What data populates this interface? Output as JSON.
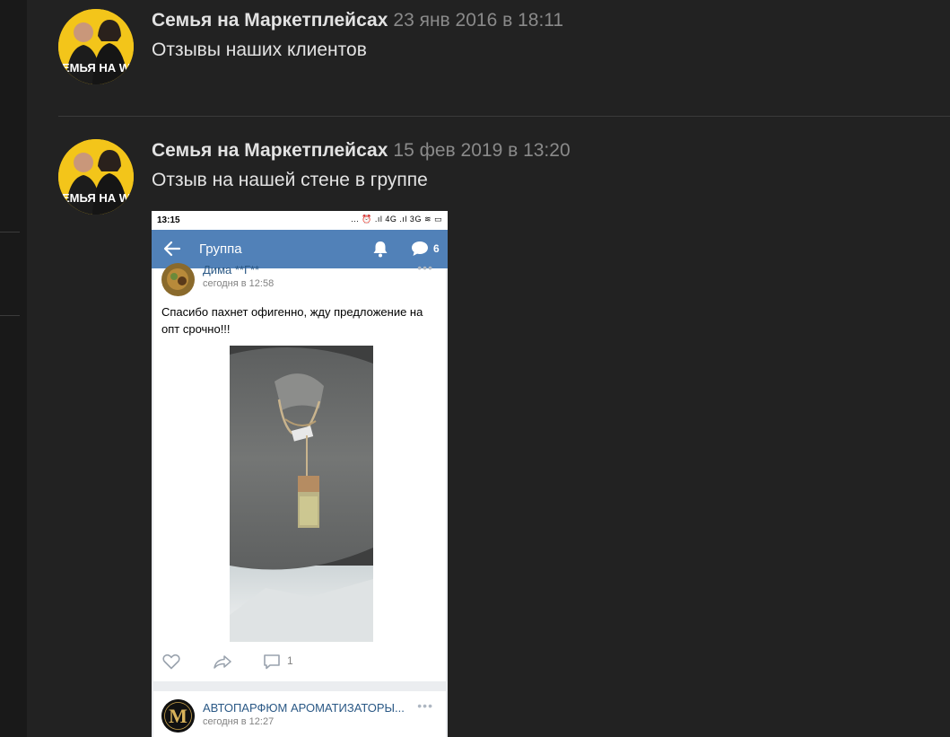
{
  "posts": [
    {
      "author": "Семья на Маркетплейсах",
      "date": "23 янв 2016 в 18:11",
      "text": "Отзывы наших клиентов",
      "avatar_text": "СЕМЬЯ НА WB"
    },
    {
      "author": "Семья на Маркетплейсах",
      "date": "15 фев 2019 в 13:20",
      "text": "Отзыв на нашей стене в группе",
      "avatar_text": "СЕМЬЯ НА WB"
    }
  ],
  "phone": {
    "status_time": "13:15",
    "status_icons": "... ⏰ .ıl 4G .ıl 3G ≋ ▭",
    "appbar": {
      "title": "Группа",
      "comment_count": "6",
      "icons": [
        "back-arrow-icon",
        "bell-icon",
        "chat-icon"
      ]
    },
    "review": {
      "author": "Дима **Г**",
      "time": "сегодня в 12:58",
      "text": "Спасибо пахнет офигенно, жду предложение на опт срочно!!!",
      "comments": "1"
    },
    "next_post": {
      "author": "АВТОПАРФЮМ АРОМАТИЗАТОРЫ...",
      "time": "сегодня в 12:27",
      "logo_letter": "M"
    },
    "menu_dots": "•••"
  },
  "colors": {
    "page_bg": "#222222",
    "vk_blue": "#5181b8",
    "link_blue": "#2a5885",
    "author_text": "#e3e3e3",
    "date_text": "#8a8a8a"
  }
}
